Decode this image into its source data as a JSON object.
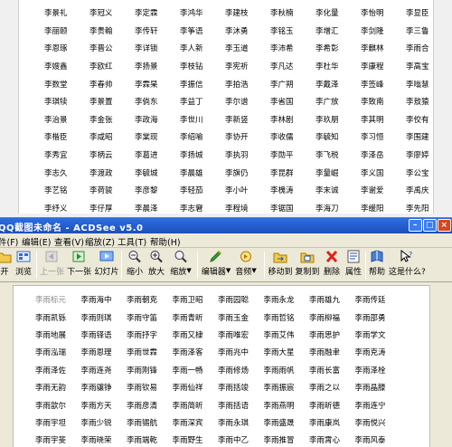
{
  "background_doc": {
    "rows": [
      [
        "李景礼",
        "李冠义",
        "李定霖",
        "李鸿华",
        "李建枝",
        "李秋楠",
        "李化量",
        "李怡明",
        "李显臣"
      ],
      [
        "李丽颐",
        "李贵翰",
        "李传轩",
        "李筝语",
        "李沐勇",
        "李铭玉",
        "李增汇",
        "李剑隆",
        "李三鲁"
      ],
      [
        "李恩琢",
        "李晋公",
        "李详锁",
        "李人新",
        "李玉道",
        "李沛希",
        "李希彰",
        "李麒林",
        "李雨合"
      ],
      [
        "李嫂鑫",
        "李欧红",
        "李扬景",
        "李枝钻",
        "李宪祈",
        "李凡达",
        "李杜华",
        "李康程",
        "李高宝"
      ],
      [
        "李数堂",
        "李春帅",
        "李霖杲",
        "李振信",
        "李拍浩",
        "李广朔",
        "李戴泽",
        "李签峰",
        "李嗡慧"
      ],
      [
        "李琪犊",
        "李景置",
        "李倘东",
        "李益丁",
        "李尔谱",
        "李省国",
        "李广放",
        "李致南",
        "李敖猿"
      ],
      [
        "李治景",
        "李金张",
        "李政海",
        "李世川",
        "李新竖",
        "李林剧",
        "李玖朋",
        "李其明",
        "李佼有"
      ],
      [
        "李楷臣",
        "李咸昭",
        "李棠现",
        "李绍喻",
        "李协开",
        "李收儒",
        "李毓知",
        "李习恒",
        "李围建"
      ],
      [
        "李秀宜",
        "李柄云",
        "李葛进",
        "李扬城",
        "李执羽",
        "李勋平",
        "李飞税",
        "李泽岳",
        "李廖婷"
      ],
      [
        "李志久",
        "李渡政",
        "李毓城",
        "李晨雄",
        "李旗仍",
        "李昆群",
        "李量崛",
        "李义国",
        "李公宝"
      ],
      [
        "李艺铭",
        "李荷骏",
        "李彦黎",
        "李轻茄",
        "李小叶",
        "李槐涛",
        "李末诚",
        "李谢爱",
        "李禹庆"
      ],
      [
        "李纾义",
        "李仔厚",
        "李晨泽",
        "李志窘",
        "李程境",
        "李锯国",
        "李海刀",
        "李缓阳",
        "李先阳"
      ]
    ]
  },
  "window": {
    "title": "QQ截图未命名 - ACDSee v5.0",
    "menu": [
      "件(F)",
      "编辑(E)",
      "查看(V)",
      "缩放(Z)",
      "工具(T)",
      "帮助(H)"
    ]
  },
  "toolbar": {
    "buttons": [
      {
        "label": "开",
        "icon": "open-icon"
      },
      {
        "label": "浏览",
        "icon": "browse-icon"
      },
      {
        "label": "上一张",
        "icon": "prev-icon",
        "disabled": true
      },
      {
        "label": "下一张",
        "icon": "next-icon"
      },
      {
        "label": "幻灯片",
        "icon": "slideshow-icon"
      },
      {
        "label": "缩小",
        "icon": "zoom-out-icon"
      },
      {
        "label": "放大",
        "icon": "zoom-in-icon"
      },
      {
        "label": "缩放",
        "icon": "zoom-icon"
      },
      {
        "label": "编辑器",
        "icon": "editor-icon"
      },
      {
        "label": "音频",
        "icon": "audio-icon"
      },
      {
        "label": "移动到",
        "icon": "move-to-icon"
      },
      {
        "label": "复制到",
        "icon": "copy-to-icon"
      },
      {
        "label": "删除",
        "icon": "delete-icon"
      },
      {
        "label": "属性",
        "icon": "properties-icon"
      },
      {
        "label": "帮助",
        "icon": "help-icon"
      },
      {
        "label": "这是什么?",
        "icon": "whats-this-icon"
      }
    ]
  },
  "viewer_doc": {
    "rows": [
      [
        "李雨标元",
        "李雨海中",
        "李雨朝克",
        "李雨卫昭",
        "李雨园聪",
        "李雨永龙",
        "李雨雄九",
        "李雨传廷"
      ],
      [
        "李雨凯铄",
        "李雨则琪",
        "李雨守笛",
        "李雨青昕",
        "李雨玉金",
        "李雨哲铭",
        "李雨柳福",
        "李雨邵勇"
      ],
      [
        "李雨地展",
        "李雨铎语",
        "李雨抒字",
        "李雨又棣",
        "李雨唯宏",
        "李雨艾伟",
        "李雨思护",
        "李雨学文"
      ],
      [
        "李雨泓瑞",
        "李雨恩理",
        "李雨世霖",
        "李雨泽客",
        "李雨兆中",
        "李雨大星",
        "李雨融聿",
        "李雨克涛"
      ],
      [
        "李雨泽佐",
        "李雨连尧",
        "李雨刚锋",
        "李雨一畅",
        "李雨修炀",
        "李雨雨帆",
        "李雨长富",
        "李雨泽栓"
      ],
      [
        "李雨无韵",
        "李雨骧铮",
        "李雨钦易",
        "李雨仙祥",
        "李雨括竣",
        "李雨振宸",
        "李雨之以",
        "李雨晶滕"
      ],
      [
        "李雨歆尔",
        "李雨方天",
        "李雨彦清",
        "李雨简昕",
        "李雨括语",
        "李雨燕明",
        "李雨昕德",
        "李雨连宁"
      ],
      [
        "李雨宇坦",
        "李雨少锐",
        "李雨锡航",
        "李雨深宾",
        "李雨永琪",
        "李雨盛晟",
        "李雨康岚",
        "李雨悦兴"
      ],
      [
        "李雨宇斐",
        "李雨晓荣",
        "李雨端乾",
        "李雨野生",
        "李雨中乙",
        "李雨推冒",
        "李雨霄心",
        "李雨风泰"
      ]
    ]
  },
  "colors": {
    "titlebar": "#1d4fb8",
    "chrome": "#ece9d8",
    "delete_red": "#d9261c"
  }
}
